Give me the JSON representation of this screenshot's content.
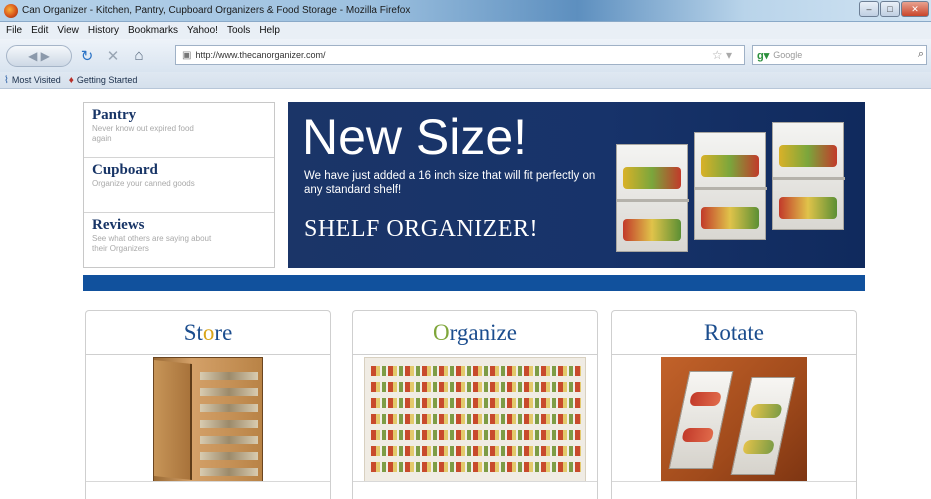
{
  "window": {
    "title": "Can Organizer - Kitchen, Pantry, Cupboard Organizers & Food Storage - Mozilla Firefox"
  },
  "menu": [
    "File",
    "Edit",
    "View",
    "History",
    "Bookmarks",
    "Yahoo!",
    "Tools",
    "Help"
  ],
  "navbar": {
    "url": "http://www.thecanorganizer.com/",
    "search_placeholder": "Google"
  },
  "bookmarks": [
    {
      "label": "Most Visited",
      "icon": "most-visited-icon"
    },
    {
      "label": "Getting Started",
      "icon": "getting-started-icon"
    }
  ],
  "sidenav": [
    {
      "title": "Pantry",
      "desc": "Never know out expired food again"
    },
    {
      "title": "Cupboard",
      "desc": "Organize your canned goods"
    },
    {
      "title": "Reviews",
      "desc": "See what others are saying about their Organizers"
    }
  ],
  "banner": {
    "title": "New Size!",
    "subtitle": "We have just added a 16 inch size that will fit perfectly on any standard shelf!",
    "cta": "SHELF ORGANIZER!"
  },
  "cards": [
    {
      "first": "St",
      "accent": "o",
      "rest": "re"
    },
    {
      "first": "",
      "accent": "O",
      "rest": "rganize"
    },
    {
      "first": "R",
      "accent": "o",
      "rest": "tate"
    }
  ],
  "colors": {
    "brand_navy": "#1b3568",
    "strip_blue": "#11519d",
    "heading_blue": "#1b4d8e",
    "accent_yellow": "#d9a51a",
    "accent_green": "#7fa63a"
  }
}
